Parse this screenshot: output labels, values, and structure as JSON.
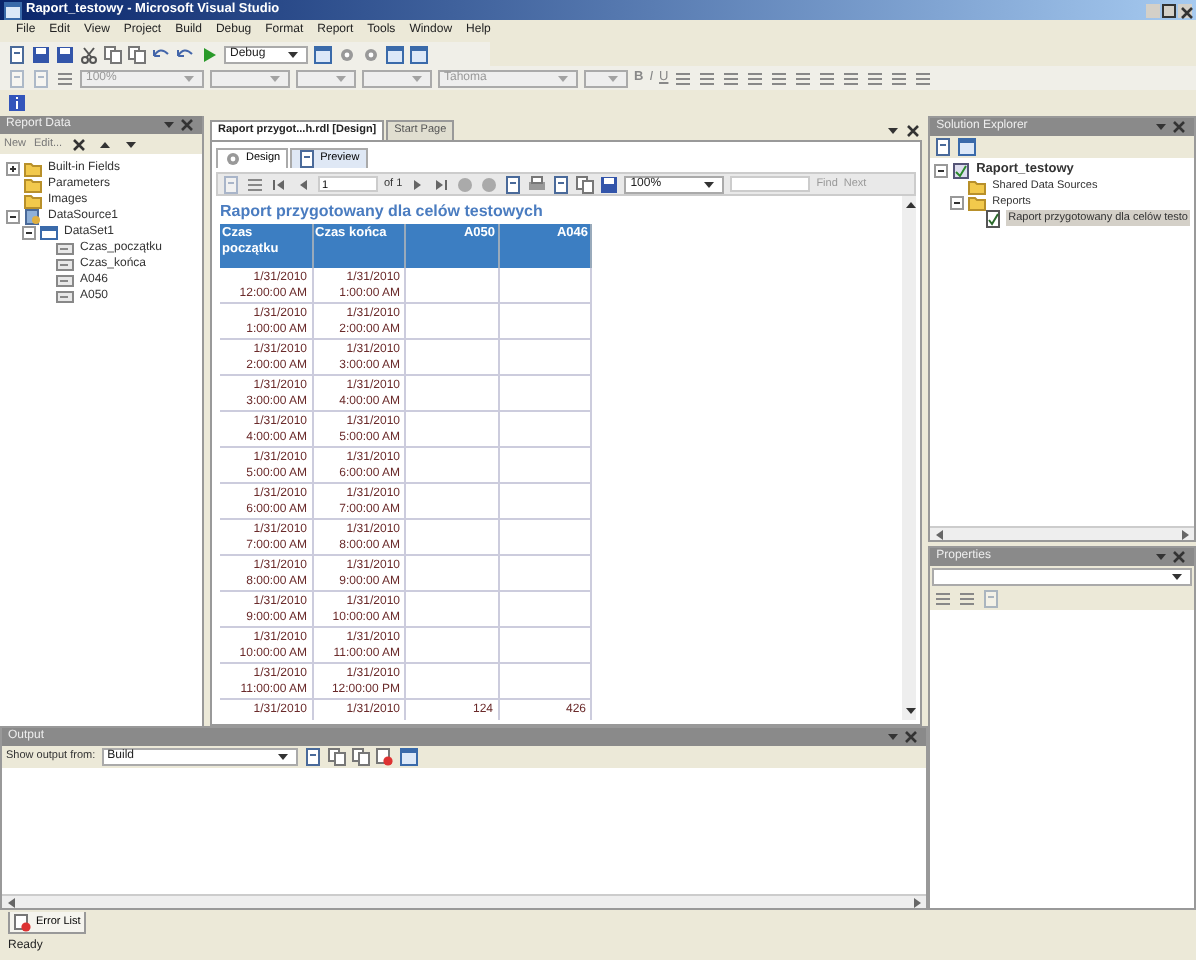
{
  "window": {
    "title": "Raport_testowy - Microsoft Visual Studio"
  },
  "menu": [
    "File",
    "Edit",
    "View",
    "Project",
    "Build",
    "Debug",
    "Format",
    "Report",
    "Tools",
    "Window",
    "Help"
  ],
  "toolbar": {
    "configuration": "Debug",
    "zoom": "100%",
    "font": "Tahoma",
    "format_buttons": [
      "B",
      "I",
      "U"
    ]
  },
  "report_data": {
    "title": "Report Data",
    "actions": [
      "New",
      "Edit..."
    ],
    "tree": [
      {
        "label": "Built-in Fields",
        "kind": "folder",
        "expanded": false
      },
      {
        "label": "Parameters",
        "kind": "folder"
      },
      {
        "label": "Images",
        "kind": "folder"
      },
      {
        "label": "DataSource1",
        "kind": "datasource",
        "expanded": true,
        "children": [
          {
            "label": "DataSet1",
            "kind": "dataset",
            "expanded": true,
            "children": [
              {
                "label": "Czas_początku",
                "kind": "field"
              },
              {
                "label": "Czas_końca",
                "kind": "field"
              },
              {
                "label": "A046",
                "kind": "field"
              },
              {
                "label": "A050",
                "kind": "field"
              }
            ]
          }
        ]
      }
    ]
  },
  "document_tabs": [
    {
      "label": "Raport przygot...h.rdl [Design]",
      "selected": true
    },
    {
      "label": "Start Page",
      "selected": false
    }
  ],
  "view_tabs": [
    {
      "label": "Design",
      "selected": false
    },
    {
      "label": "Preview",
      "selected": true
    }
  ],
  "report_toolbar": {
    "page": "1",
    "page_count": "of 1",
    "zoom": "100%",
    "find": "Find",
    "next": "Next"
  },
  "report": {
    "title": "Raport przygotowany dla celów testowych",
    "columns": [
      "Czas początku",
      "Czas końca",
      "A050",
      "A046"
    ],
    "rows": [
      {
        "start": "1/31/2010 12:00:00 AM",
        "end": "1/31/2010 1:00:00 AM"
      },
      {
        "start": "1/31/2010 1:00:00 AM",
        "end": "1/31/2010 2:00:00 AM"
      },
      {
        "start": "1/31/2010 2:00:00 AM",
        "end": "1/31/2010 3:00:00 AM"
      },
      {
        "start": "1/31/2010 3:00:00 AM",
        "end": "1/31/2010 4:00:00 AM"
      },
      {
        "start": "1/31/2010 4:00:00 AM",
        "end": "1/31/2010 5:00:00 AM"
      },
      {
        "start": "1/31/2010 5:00:00 AM",
        "end": "1/31/2010 6:00:00 AM"
      },
      {
        "start": "1/31/2010 6:00:00 AM",
        "end": "1/31/2010 7:00:00 AM"
      },
      {
        "start": "1/31/2010 7:00:00 AM",
        "end": "1/31/2010 8:00:00 AM"
      },
      {
        "start": "1/31/2010 8:00:00 AM",
        "end": "1/31/2010 9:00:00 AM"
      },
      {
        "start": "1/31/2010 9:00:00 AM",
        "end": "1/31/2010 10:00:00 AM"
      },
      {
        "start": "1/31/2010 10:00:00 AM",
        "end": "1/31/2010 11:00:00 AM"
      },
      {
        "start": "1/31/2010 11:00:00 AM",
        "end": "1/31/2010 12:00:00 PM"
      },
      {
        "start": "1/31/2010",
        "end": "1/31/2010",
        "a050": "124",
        "a046": "426"
      }
    ]
  },
  "solution_explorer": {
    "title": "Solution Explorer",
    "tree": [
      {
        "label": "Raport_testowy",
        "kind": "project",
        "expanded": true,
        "children": [
          {
            "label": "Shared Data Sources",
            "kind": "folder"
          },
          {
            "label": "Reports",
            "kind": "folder",
            "expanded": true,
            "children": [
              {
                "label": "Raport przygotowany dla celów testo",
                "kind": "report",
                "selected": true
              }
            ]
          }
        ]
      }
    ]
  },
  "properties": {
    "title": "Properties"
  },
  "output": {
    "title": "Output",
    "source_label": "Show output from:",
    "source": "Build"
  },
  "bottom_tabs": [
    {
      "label": "Error List"
    }
  ],
  "status_bar": "Ready"
}
